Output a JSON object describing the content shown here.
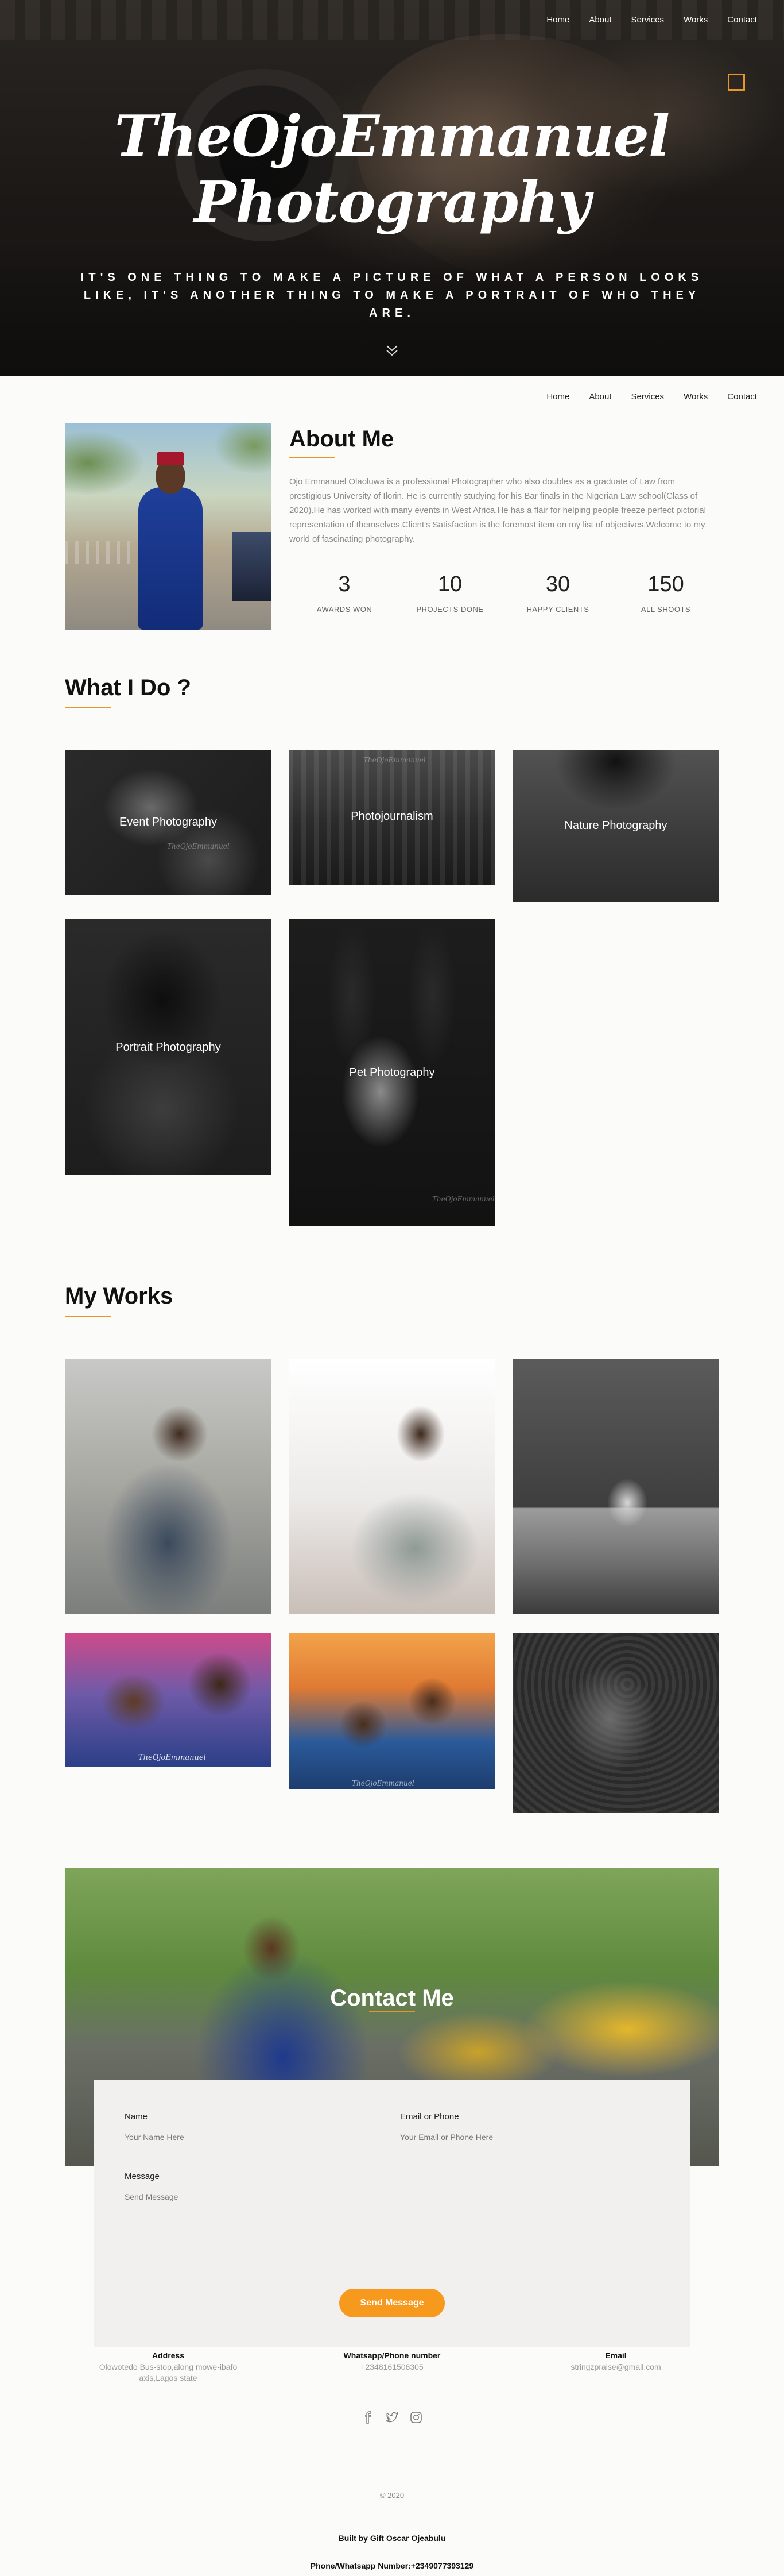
{
  "nav": {
    "items": [
      "Home",
      "About",
      "Services",
      "Works",
      "Contact"
    ]
  },
  "hero": {
    "title": "TheOjoEmmanuel Photography",
    "quote": "IT'S ONE THING TO MAKE A PICTURE OF WHAT A PERSON LOOKS LIKE, IT'S ANOTHER THING TO MAKE A PORTRAIT OF WHO THEY ARE.",
    "scroll_icon": "double-chevron-down-icon",
    "accent_color": "#e8962a"
  },
  "about": {
    "heading": "About Me",
    "text": "Ojo Emmanuel Olaoluwa is a professional Photographer who also doubles as a graduate of Law from prestigious University of Ilorin. He is currently studying for his Bar finals in the Nigerian Law school(Class of 2020).He has worked with many events in West Africa.He has a flair for helping people freeze perfect pictorial representation of themselves.Client's Satisfaction is the foremost item on my list of objectives.Welcome to my world of fascinating photography.",
    "stats": [
      {
        "value": "3",
        "label": "AWARDS WON"
      },
      {
        "value": "10",
        "label": "PROJECTS DONE"
      },
      {
        "value": "30",
        "label": "HAPPY CLIENTS"
      },
      {
        "value": "150",
        "label": "ALL SHOOTS"
      }
    ]
  },
  "services": {
    "heading": "What I Do ?",
    "items": [
      "Event Photography",
      "Photojournalism",
      "Nature Photography",
      "Portrait Photography",
      "Pet Photography"
    ],
    "watermark": "TheOjoEmmanuel"
  },
  "works": {
    "heading": "My Works",
    "watermark": "TheOjoEmmanuel"
  },
  "contact": {
    "heading": "Contact Me",
    "name_label": "Name",
    "name_placeholder": "Your Name Here",
    "email_label": "Email or Phone",
    "email_placeholder": "Your Email or Phone Here",
    "message_label": "Message",
    "message_placeholder": "Send Message",
    "send_label": "Send Message",
    "button_color": "#f7991c",
    "address_title": "Address",
    "address_value": "Olowotedo Bus-stop,along mowe-ibafo axis,Lagos state",
    "phone_title": "Whatsapp/Phone number",
    "phone_value": "+2348161506305",
    "email_title": "Email",
    "email_value": "stringzpraise@gmail.com",
    "social_icons": [
      "facebook-icon",
      "twitter-icon",
      "instagram-icon"
    ]
  },
  "footer": {
    "copyright": "© 2020",
    "built_by": "Built by Gift Oscar Ojeabulu",
    "phone": "Phone/Whatsapp Number:+2349077393129"
  }
}
